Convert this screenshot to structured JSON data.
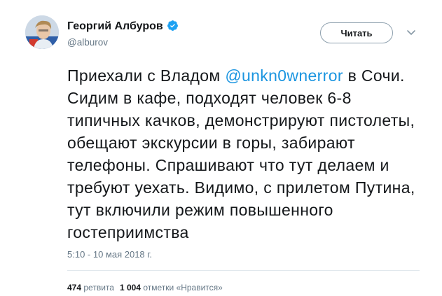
{
  "author": {
    "display_name": "Георгий Албуров",
    "handle": "@alburov",
    "verified": true
  },
  "follow_button": {
    "label": "Читать"
  },
  "tweet": {
    "text_before": "Приехали с Владом ",
    "mention": "@unkn0wnerror",
    "text_after": " в Сочи. Сидим в кафе, подходят человек 6-8 типичных качков, демонстрируют пистолеты, обещают экскурсии в горы, забирают телефоны. Спрашивают что тут делаем и требуют уехать. Видимо, с прилетом Путина, тут включили режим повышенного гостеприимства",
    "timestamp": "5:10 - 10 мая 2018 г."
  },
  "stats": {
    "retweets_count": "474",
    "retweets_label": "ретвита",
    "likes_count": "1 004",
    "likes_label": "отметки «Нравится»"
  },
  "colors": {
    "link": "#1b95e0",
    "secondary_text": "#657786",
    "primary_text": "#14171a",
    "verified_badge": "#1da1f2"
  },
  "icons": {
    "verified": "verified-badge-icon",
    "caret": "chevron-down-icon"
  }
}
